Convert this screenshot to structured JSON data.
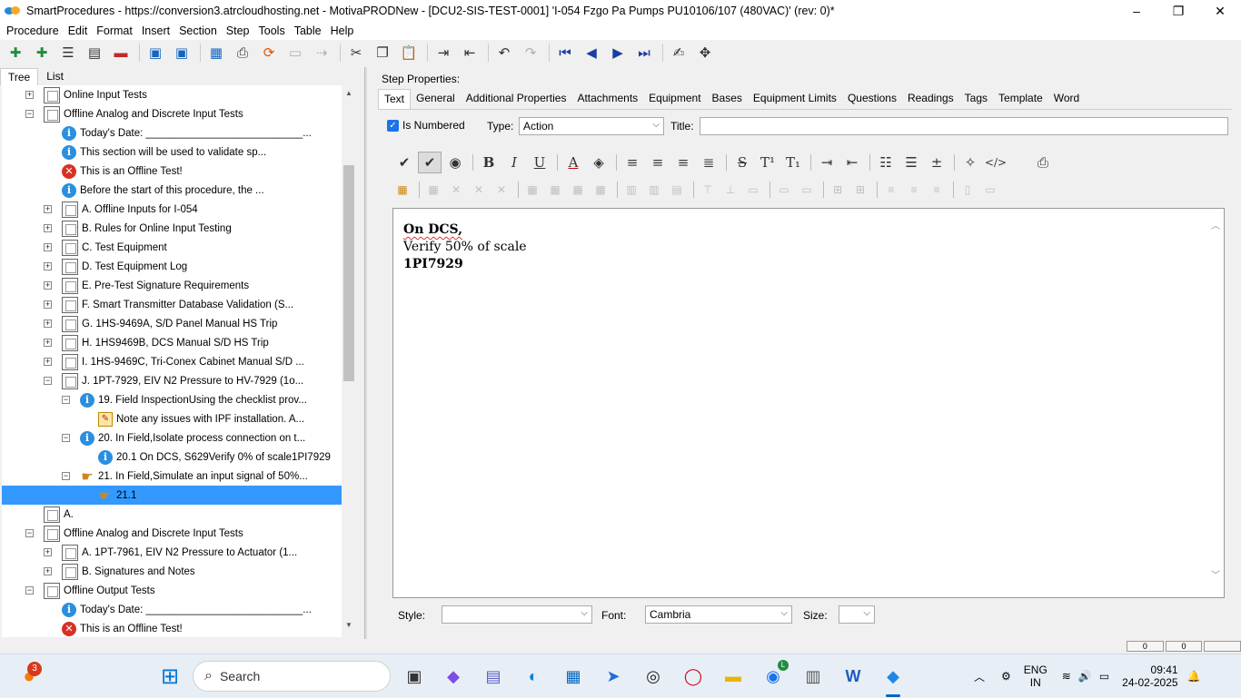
{
  "window": {
    "title": "SmartProcedures - https://conversion3.atrcloudhosting.net - MotivaPRODNew - [DCU2-SIS-TEST-0001] 'I-054 Fzgo Pa Pumps PU10106/107 (480VAC)' (rev: 0)*",
    "minimize": "–",
    "maximize": "❐",
    "close": "✕"
  },
  "menu": [
    "Procedure",
    "Edit",
    "Format",
    "Insert",
    "Section",
    "Step",
    "Tools",
    "Table",
    "Help"
  ],
  "left_tabs": [
    "Tree",
    "List"
  ],
  "tree": [
    {
      "label": "Online Input Tests",
      "icon": "doc",
      "exp": "+",
      "level": 1
    },
    {
      "label": "Offline Analog and Discrete Input Tests",
      "icon": "doc",
      "exp": "−",
      "level": 1
    },
    {
      "label": "Today's Date: ___________________________...",
      "icon": "info",
      "exp": "",
      "level": 2
    },
    {
      "label": "This section will be used to validate sp...",
      "icon": "info",
      "exp": "",
      "level": 2
    },
    {
      "label": "This is an Offline Test!",
      "icon": "err",
      "exp": "",
      "level": 2
    },
    {
      "label": "Before the start of this procedure, the ...",
      "icon": "info",
      "exp": "",
      "level": 2
    },
    {
      "label": "A. Offline Inputs for I-054",
      "icon": "doc",
      "exp": "+",
      "level": 2
    },
    {
      "label": "B. Rules for Online Input Testing",
      "icon": "doc",
      "exp": "+",
      "level": 2
    },
    {
      "label": "C. Test Equipment",
      "icon": "doc",
      "exp": "+",
      "level": 2
    },
    {
      "label": "D. Test Equipment Log",
      "icon": "doc",
      "exp": "+",
      "level": 2
    },
    {
      "label": "E. Pre-Test Signature Requirements",
      "icon": "doc",
      "exp": "+",
      "level": 2
    },
    {
      "label": "F. Smart Transmitter Database Validation (S...",
      "icon": "doc",
      "exp": "+",
      "level": 2
    },
    {
      "label": "G. 1HS-9469A, S/D Panel Manual HS Trip",
      "icon": "doc",
      "exp": "+",
      "level": 2
    },
    {
      "label": "H. 1HS9469B, DCS Manual S/D HS Trip",
      "icon": "doc",
      "exp": "+",
      "level": 2
    },
    {
      "label": "I. 1HS-9469C, Tri-Conex Cabinet Manual S/D ...",
      "icon": "doc",
      "exp": "+",
      "level": 2
    },
    {
      "label": "J. 1PT-7929, EIV N2 Pressure to HV-7929 (1o...",
      "icon": "doc",
      "exp": "−",
      "level": 2
    },
    {
      "label": "19. Field InspectionUsing the checklist prov...",
      "icon": "info",
      "exp": "−",
      "level": 3
    },
    {
      "label": "Note any issues with IPF installation. A...",
      "icon": "note",
      "exp": "",
      "level": 4
    },
    {
      "label": "20. In Field,Isolate process connection on t...",
      "icon": "info",
      "exp": "−",
      "level": 3
    },
    {
      "label": "20.1 On DCS, S629Verify 0% of scale1PI7929",
      "icon": "info",
      "exp": "",
      "level": 4
    },
    {
      "label": "21. In Field,Simulate an input signal of 50%...",
      "icon": "hand",
      "exp": "−",
      "level": 3
    },
    {
      "label": "21.1",
      "icon": "hand",
      "exp": "",
      "level": 4,
      "selected": true
    },
    {
      "label": "A.",
      "icon": "doc",
      "exp": "",
      "level": 1
    },
    {
      "label": "Offline Analog and Discrete Input Tests",
      "icon": "doc",
      "exp": "−",
      "level": 1
    },
    {
      "label": "A. 1PT-7961, EIV N2 Pressure to Actuator (1...",
      "icon": "doc",
      "exp": "+",
      "level": 2
    },
    {
      "label": "B. Signatures and Notes",
      "icon": "doc",
      "exp": "+",
      "level": 2
    },
    {
      "label": "Offline Output Tests",
      "icon": "doc",
      "exp": "−",
      "level": 1
    },
    {
      "label": "Today's Date: ___________________________...",
      "icon": "info",
      "exp": "",
      "level": 2
    },
    {
      "label": "This is an Offline Test!",
      "icon": "err",
      "exp": "",
      "level": 2
    }
  ],
  "step_properties": {
    "label": "Step Properties:",
    "tabs": [
      "Text",
      "General",
      "Additional Properties",
      "Attachments",
      "Equipment",
      "Bases",
      "Equipment Limits",
      "Questions",
      "Readings",
      "Tags",
      "Template",
      "Word"
    ],
    "is_numbered_label": "Is Numbered",
    "is_numbered": true,
    "type_label": "Type:",
    "type_value": "Action",
    "title_label": "Title:",
    "title_value": ""
  },
  "editor": {
    "line1": "On DCS,",
    "line2": "Verify 50% of scale",
    "line3": "1PI7929"
  },
  "bottom": {
    "style_label": "Style:",
    "style_value": "",
    "font_label": "Font:",
    "font_value": "Cambria",
    "size_label": "Size:",
    "size_value": ""
  },
  "status": [
    "0",
    "0"
  ],
  "taskbar": {
    "search_label": "Search",
    "notification_count": "3",
    "lang_line1": "ENG",
    "lang_line2": "IN",
    "time": "09:41",
    "date": "24-02-2025",
    "chrome_badge": "L"
  }
}
